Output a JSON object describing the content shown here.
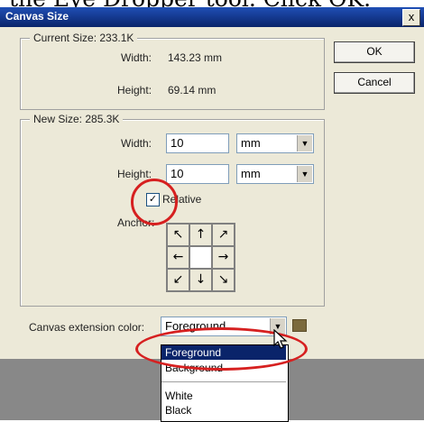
{
  "caption": {
    "text": "the Eye Dropper tool. Click OK."
  },
  "window": {
    "title": "Canvas Size",
    "close_label": "x"
  },
  "current_size": {
    "label": "Current Size: 233.1K",
    "width_label": "Width:",
    "width_value": "143.23 mm",
    "height_label": "Height:",
    "height_value": "69.14 mm"
  },
  "new_size": {
    "label": "New Size: 285.3K",
    "width_label": "Width:",
    "width_value": "10",
    "width_unit": "mm",
    "height_label": "Height:",
    "height_value": "10",
    "height_unit": "mm",
    "relative_label": "Relative",
    "relative_checked": "✓",
    "anchor_label": "Anchor:"
  },
  "anchor_arrows": [
    "↖",
    "↑",
    "↗",
    "←",
    "",
    "→",
    "↙",
    "↓",
    "↘"
  ],
  "buttons": {
    "ok": "OK",
    "cancel": "Cancel"
  },
  "extension": {
    "label": "Canvas extension color:",
    "selected": "Foreground",
    "options": [
      "Foreground",
      "Background",
      "White",
      "Black"
    ],
    "swatch_color": "#7b6a3d"
  },
  "colors": {
    "title_bar": "#0a246a",
    "highlight": "#0a246a",
    "annotation_red": "#d62020"
  }
}
